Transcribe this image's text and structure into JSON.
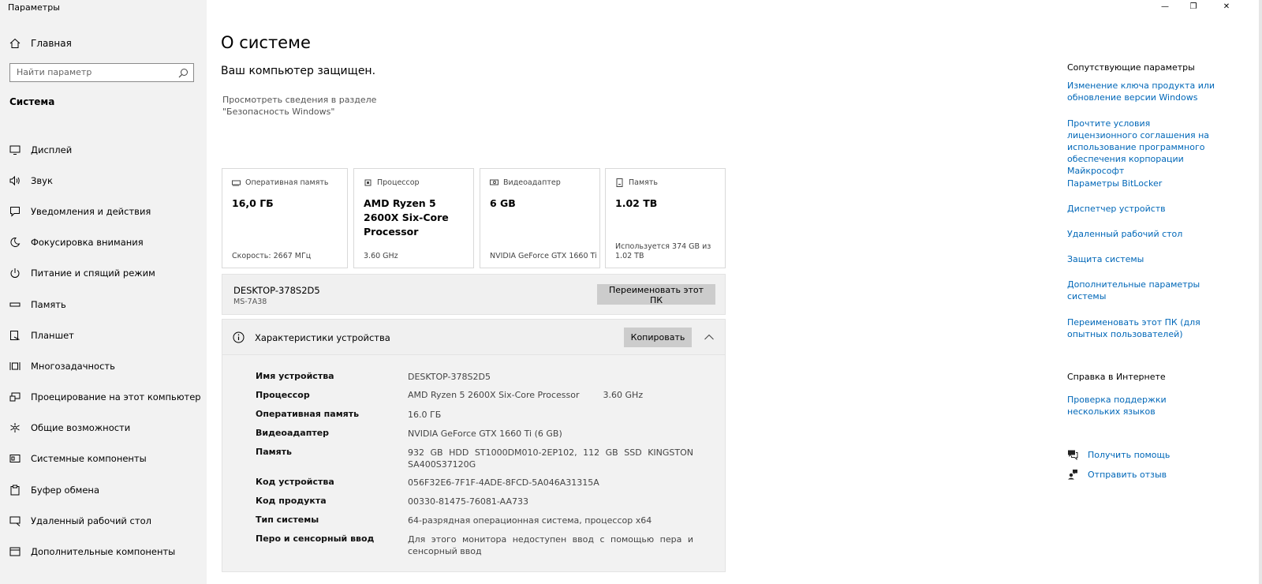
{
  "app": {
    "title": "Параметры"
  },
  "window_controls": {
    "minimize": "—",
    "restore": "❐",
    "close": "✕"
  },
  "sidebar": {
    "home_label": "Главная",
    "search_placeholder": "Найти параметр",
    "section_title": "Система",
    "items": [
      {
        "label": "Дисплей",
        "icon": "monitor-icon"
      },
      {
        "label": "Звук",
        "icon": "speaker-icon"
      },
      {
        "label": "Уведомления и действия",
        "icon": "notification-icon"
      },
      {
        "label": "Фокусировка внимания",
        "icon": "moon-icon"
      },
      {
        "label": "Питание и спящий режим",
        "icon": "power-icon"
      },
      {
        "label": "Память",
        "icon": "storage-icon"
      },
      {
        "label": "Планшет",
        "icon": "tablet-icon"
      },
      {
        "label": "Многозадачность",
        "icon": "multitask-icon"
      },
      {
        "label": "Проецирование на этот компьютер",
        "icon": "project-icon"
      },
      {
        "label": "Общие возможности",
        "icon": "shared-icon"
      },
      {
        "label": "Системные компоненты",
        "icon": "components-icon"
      },
      {
        "label": "Буфер обмена",
        "icon": "clipboard-icon"
      },
      {
        "label": "Удаленный рабочий стол",
        "icon": "remote-icon"
      },
      {
        "label": "Дополнительные компоненты",
        "icon": "optional-icon"
      }
    ]
  },
  "main": {
    "title": "О системе",
    "protection_heading": "Ваш компьютер защищен.",
    "protection_link": "Просмотреть сведения в разделе \"Безопасность Windows\"",
    "cards": {
      "ram": {
        "label": "Оперативная память",
        "value": "16,0 ГБ",
        "footer": "Скорость: 2667 МГц"
      },
      "cpu": {
        "label": "Процессор",
        "value": "AMD Ryzen 5 2600X Six-Core Processor",
        "footer": "3.60 GHz"
      },
      "gpu": {
        "label": "Видеоадаптер",
        "value": "6 GB",
        "footer": "NVIDIA GeForce GTX 1660 Ti"
      },
      "storage": {
        "label": "Память",
        "value": "1.02 TB",
        "footer": "Используется 374 GB из 1.02 TB"
      }
    },
    "pc": {
      "name": "DESKTOP-378S2D5",
      "model": "MS-7A38",
      "rename_button": "Переименовать этот ПК"
    },
    "specs": {
      "title": "Характеристики устройства",
      "copy_button": "Копировать",
      "rows": [
        {
          "label": "Имя устройства",
          "value": "DESKTOP-378S2D5"
        },
        {
          "label": "Процессор",
          "value": "AMD Ryzen 5 2600X Six-Core Processor",
          "value2": "3.60 GHz"
        },
        {
          "label": "Оперативная память",
          "value": "16.0 ГБ"
        },
        {
          "label": "Видеоадаптер",
          "value": "NVIDIA GeForce GTX 1660 Ti (6 GB)"
        },
        {
          "label": "Память",
          "value": "932 GB HDD ST1000DM010-2EP102, 112 GB SSD KINGSTON SA400S37120G"
        },
        {
          "label": "Код устройства",
          "value": "056F32E6-7F1F-4ADE-8FCD-5A046A31315A"
        },
        {
          "label": "Код продукта",
          "value": "00330-81475-76081-AA733"
        },
        {
          "label": "Тип системы",
          "value": "64-разрядная операционная система, процессор x64"
        },
        {
          "label": "Перо и сенсорный ввод",
          "value": "Для этого монитора недоступен ввод с помощью пера и сенсорный ввод"
        }
      ]
    }
  },
  "right": {
    "related_title": "Сопутствующие параметры",
    "related_links": [
      "Изменение ключа продукта или обновление версии Windows",
      "Прочтите условия лицензионного соглашения на использование программного обеспечения корпорации Майкрософт",
      "Параметры BitLocker",
      "Диспетчер устройств",
      "Удаленный рабочий стол",
      "Защита системы",
      "Дополнительные параметры системы",
      "Переименовать этот ПК (для опытных пользователей)"
    ],
    "help_title": "Справка в Интернете",
    "help_links": [
      "Проверка поддержки нескольких языков"
    ],
    "get_help": "Получить помощь",
    "feedback": "Отправить отзыв"
  },
  "colors": {
    "link": "#0067b8",
    "sidebar_bg": "#f2f2f2",
    "button_bg": "#cccccc"
  }
}
